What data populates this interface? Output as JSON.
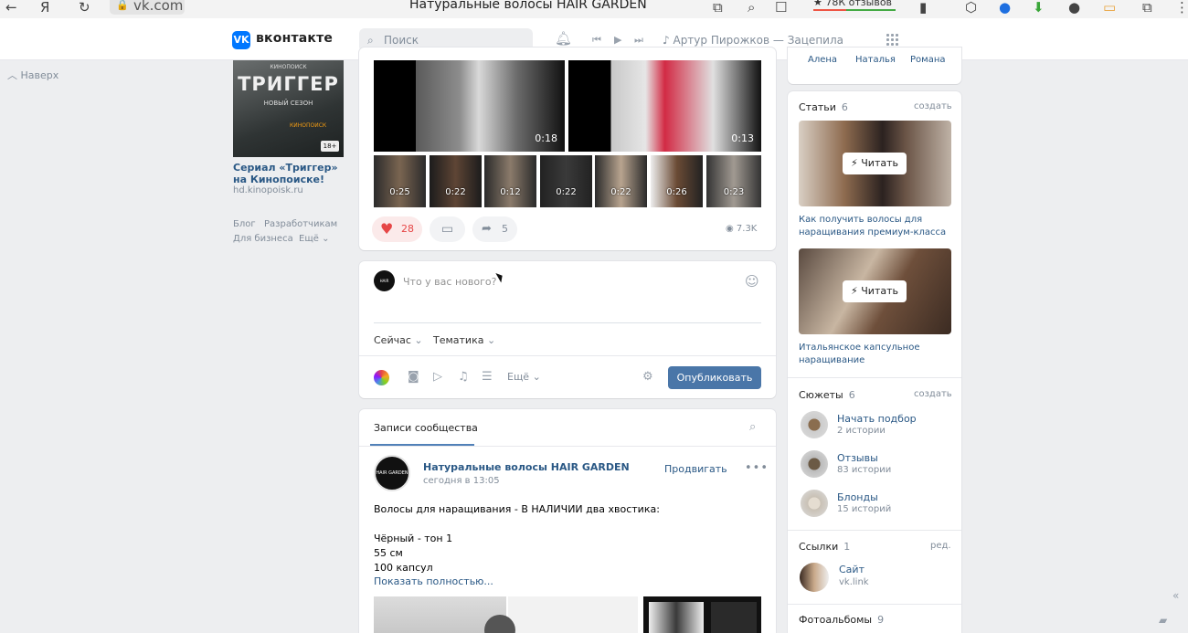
{
  "browser": {
    "url": "vk.com",
    "title": "Натуральные волосы HAIR GARDEN",
    "reviews": "★ 78К отзывов"
  },
  "header": {
    "brand": "вконтакте",
    "search_placeholder": "Поиск",
    "now_playing": "Артур Пирожков — Зацепила"
  },
  "left": {
    "up_link": "Наверх",
    "ad": {
      "img_top": "КИНОПОИСК",
      "img_title": "ТРИГГЕР",
      "img_subtitle": "НОВЫЙ СЕЗОН",
      "img_brand": "КИНОПОИСК",
      "img_age": "18+",
      "title": "Сериал «Триггер» на Кинопоиске!",
      "domain": "hd.kinopoisk.ru"
    },
    "footer": [
      "Блог",
      "Разработчикам",
      "Для бизнеса",
      "Ещё ⌄"
    ]
  },
  "videos": {
    "main": [
      "0:18",
      "0:13"
    ],
    "thumbs": [
      "0:25",
      "0:22",
      "0:12",
      "0:22",
      "0:22",
      "0:26",
      "0:23"
    ]
  },
  "actions": {
    "likes": "28",
    "shares": "5",
    "views": "7.3K"
  },
  "composer": {
    "placeholder": "Что у вас нового?",
    "time": "Сейчас",
    "topic": "Тематика",
    "more": "Ещё",
    "publish": "Опубликовать"
  },
  "feed": {
    "tab": "Записи сообщества",
    "post": {
      "author": "Натуральные волосы HAIR GARDEN",
      "time": "сегодня в 13:05",
      "promote": "Продвигать",
      "lines": [
        "Волосы для наращивания - В НАЛИЧИИ два хвостика:",
        "Чёрный - тон 1",
        "55 см",
        "100 капсул"
      ],
      "show_more": "Показать полностью..."
    }
  },
  "right": {
    "friends": [
      "Алена",
      "Наталья",
      "Романа"
    ],
    "articles": {
      "title": "Статьи",
      "count": "6",
      "action": "создать",
      "read": "Читать",
      "items": [
        "Как получить волосы для наращивания премиум-класса",
        "Итальянское капсульное наращивание"
      ]
    },
    "stories": {
      "title": "Сюжеты",
      "count": "6",
      "action": "создать",
      "items": [
        {
          "title": "Начать подбор",
          "sub": "2 истории"
        },
        {
          "title": "Отзывы",
          "sub": "83 истории"
        },
        {
          "title": "Блонды",
          "sub": "15 историй"
        }
      ]
    },
    "links": {
      "title": "Ссылки",
      "count": "1",
      "action": "ред.",
      "item_title": "Сайт",
      "item_url": "vk.link"
    },
    "albums": {
      "title": "Фотоальбомы",
      "count": "9"
    }
  },
  "colors": {
    "vk_blue": "#0077ff",
    "link": "#2a5885",
    "button": "#4a76a8",
    "like": "#e64646"
  }
}
